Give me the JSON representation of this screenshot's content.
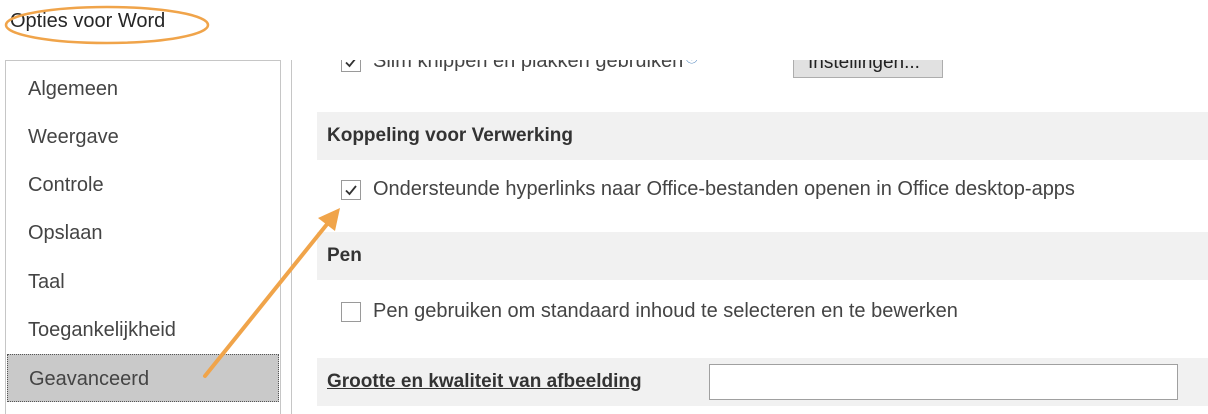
{
  "dialog": {
    "title": "Opties voor Word"
  },
  "sidebar": {
    "items": [
      {
        "label": "Algemeen",
        "selected": false
      },
      {
        "label": "Weergave",
        "selected": false
      },
      {
        "label": "Controle",
        "selected": false
      },
      {
        "label": "Opslaan",
        "selected": false
      },
      {
        "label": "Taal",
        "selected": false
      },
      {
        "label": "Toegankelijkheid",
        "selected": false
      },
      {
        "label": "Geavanceerd",
        "selected": true
      }
    ]
  },
  "content": {
    "smart_cut": {
      "label": "Slim knippen en plakken gebruiken",
      "checked": true,
      "info_icon": "info-icon",
      "settings_button": "Instellingen..."
    },
    "section_link_handling": {
      "title": "Koppeling voor Verwerking",
      "option": {
        "label": "Ondersteunde hyperlinks naar Office-bestanden openen in Office desktop-apps",
        "checked": true
      }
    },
    "section_pen": {
      "title": "Pen",
      "option": {
        "label": "Pen gebruiken om standaard inhoud te selecteren en te bewerken",
        "checked": false
      }
    },
    "section_image": {
      "title": "Grootte en kwaliteit van afbeelding",
      "document_value": ""
    }
  },
  "annotations": {
    "highlight_color": "#f0a44a",
    "title_ring": "ellipse",
    "arrow": "from Geavanceerd to hyperlinks checkbox"
  }
}
